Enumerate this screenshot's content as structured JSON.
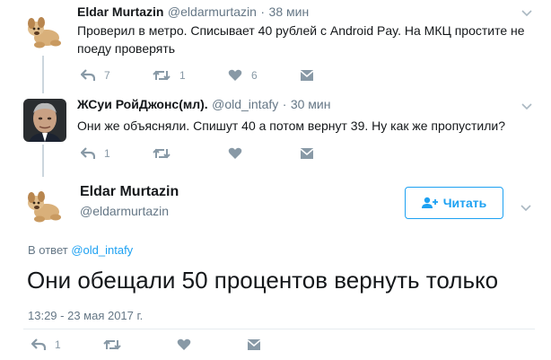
{
  "tweet1": {
    "name": "Eldar Murtazin",
    "handle": "@eldarmurtazin",
    "dot": "·",
    "time": "38 мин",
    "text_line1": "Проверил в метро. Списывает 40 рублей с Android Pay.  На МКЦ простите не",
    "text_line2": "поеду проверять",
    "replies": "7",
    "retweets": "1",
    "likes": "6"
  },
  "tweet2": {
    "name": "ЖСуи РойДжонс(мл).",
    "handle": "@old_intafy",
    "dot": "·",
    "time": "30 мин",
    "text": "Они же объясняли. Спишут 40 а потом вернут 39. Ну как же пропустили?",
    "replies": "1"
  },
  "main": {
    "name": "Eldar Murtazin",
    "handle": "@eldarmurtazin",
    "follow_label": "Читать",
    "reply_prefix": "В ответ",
    "reply_to": "@old_intafy",
    "text": "Они обещали 50 процентов вернуть только",
    "timestamp": "13:29 - 23 мая 2017 г.",
    "replies": "1"
  },
  "colors": {
    "accent": "#1da1f2",
    "muted": "#657786",
    "icon": "#8899a6",
    "line": "#ccd6dd"
  },
  "icons": [
    "reply-icon",
    "retweet-icon",
    "heart-icon",
    "message-icon",
    "chevron-down-icon",
    "follow-person-icon"
  ]
}
